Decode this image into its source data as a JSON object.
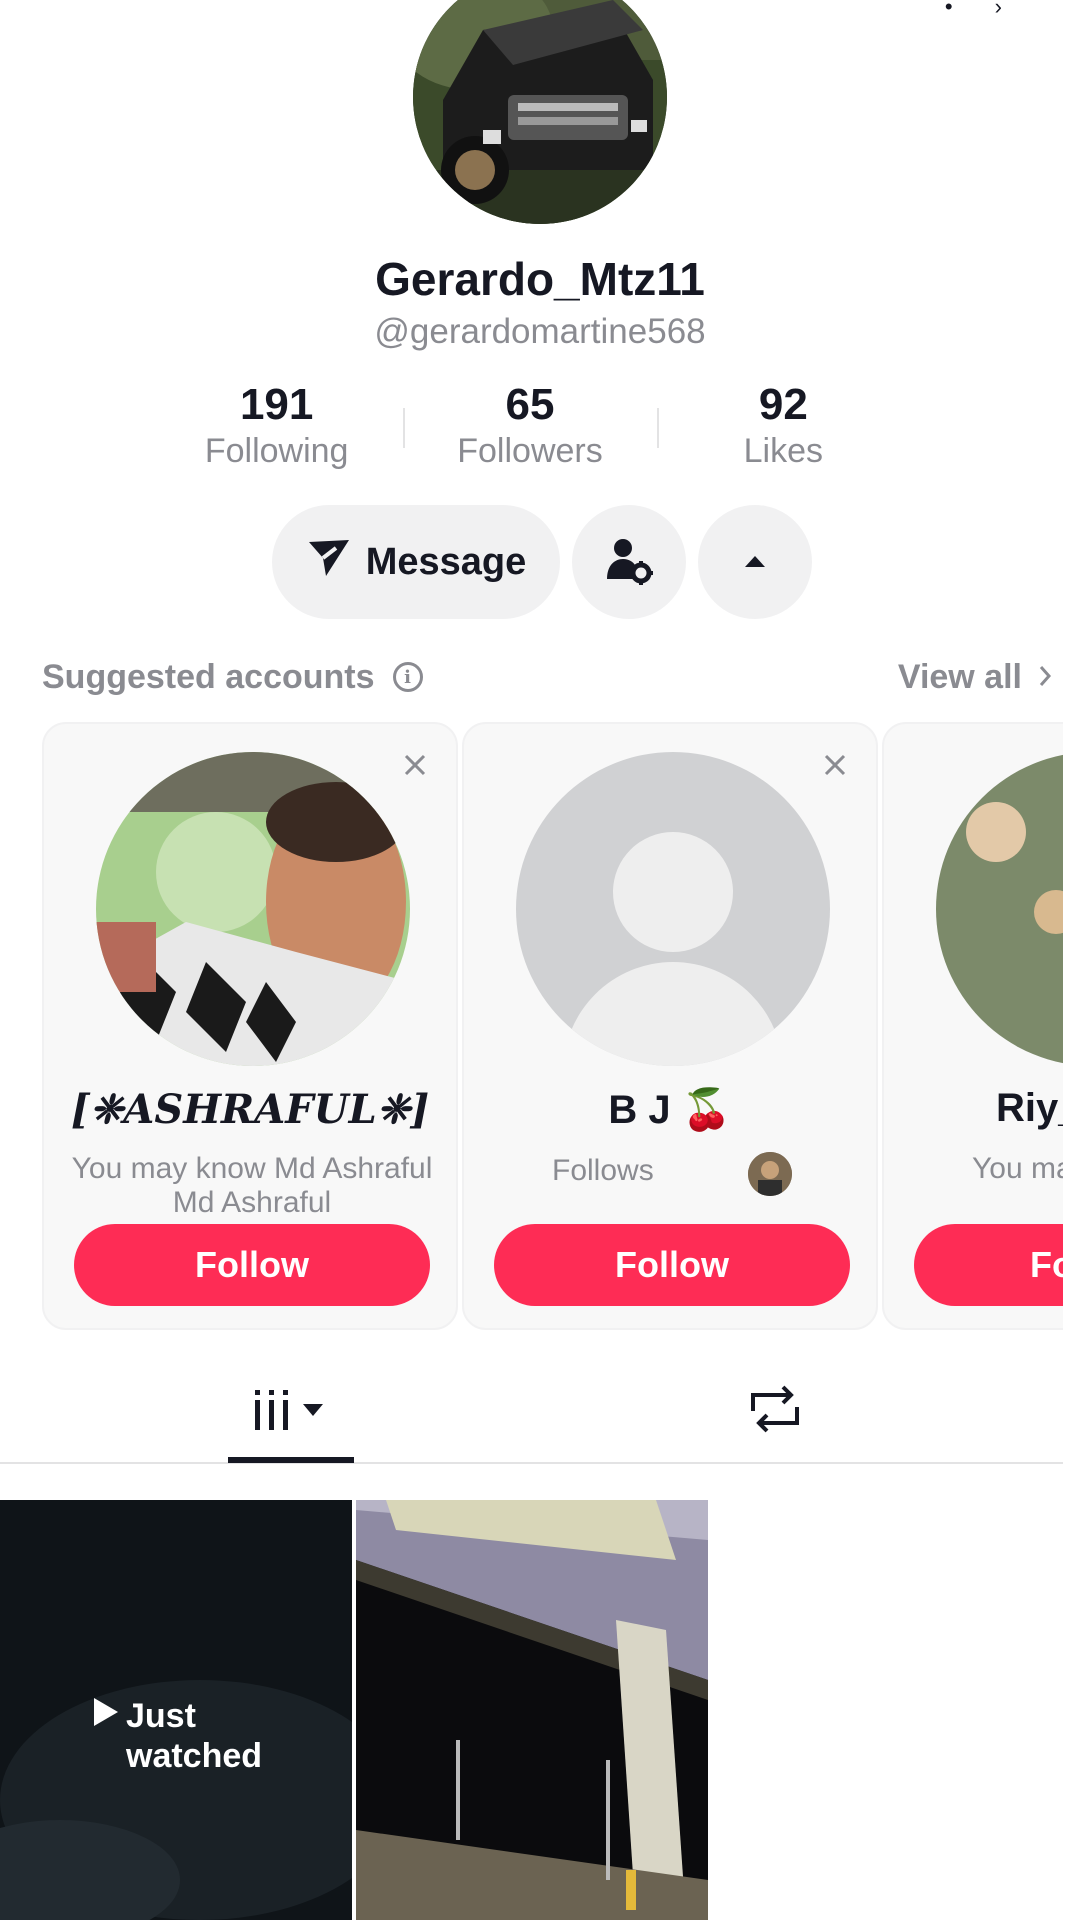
{
  "profile": {
    "display_name": "Gerardo_Mtz11",
    "handle": "@gerardomartine568"
  },
  "stats": [
    {
      "value": "191",
      "label": "Following"
    },
    {
      "value": "65",
      "label": "Followers"
    },
    {
      "value": "92",
      "label": "Likes"
    }
  ],
  "actions": {
    "message_label": "Message"
  },
  "suggested": {
    "title": "Suggested accounts",
    "view_all": "View all",
    "cards": [
      {
        "name": "[❈ASHRAFUL❈]",
        "subtitle": "You may know Md Ashraful Md Ashraful",
        "follow_label": "Follow"
      },
      {
        "name": "B J 🍒",
        "subtitle": "Follows",
        "follow_label": "Follow"
      },
      {
        "name": "Riy_",
        "subtitle": "You ma Y",
        "follow_label": "Fo"
      }
    ]
  },
  "videos": [
    {
      "overlay": "Just watched"
    }
  ],
  "colors": {
    "accent": "#fe2c55",
    "text_primary": "#161823",
    "text_secondary": "#8a8b91",
    "chip_bg": "#f1f1f2"
  }
}
